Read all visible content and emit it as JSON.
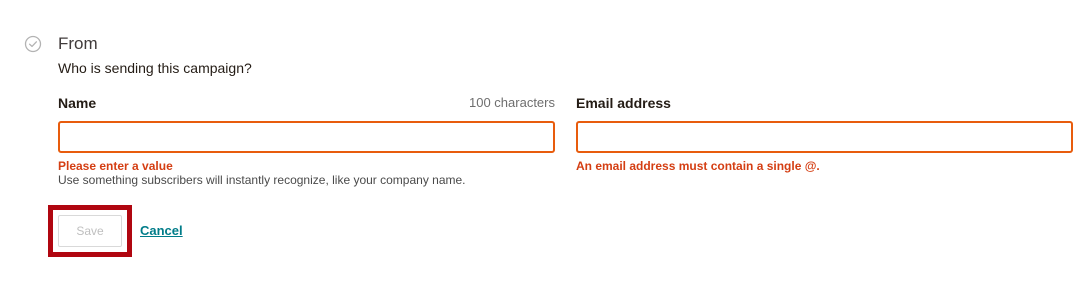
{
  "section": {
    "icon": "check-circle-icon",
    "title": "From",
    "subtitle": "Who is sending this campaign?"
  },
  "name_field": {
    "label": "Name",
    "char_count": "100 characters",
    "value": "",
    "error": "Please enter a value",
    "help": "Use something subscribers will instantly recognize, like your company name."
  },
  "email_field": {
    "label": "Email address",
    "value": "",
    "error": "An email address must contain a single @."
  },
  "actions": {
    "save_label": "Save",
    "cancel_label": "Cancel"
  },
  "colors": {
    "error": "#d43e13",
    "input_border_error": "#e85c0d",
    "link": "#007c89",
    "highlight": "#b00610"
  }
}
